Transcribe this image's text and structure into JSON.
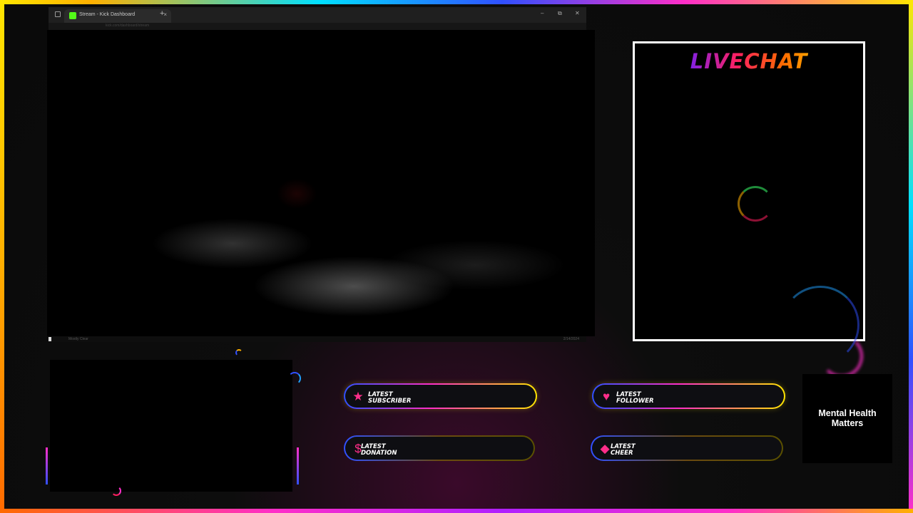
{
  "browser": {
    "tab_title": "Stream - Kick Dashboard",
    "tab_close": "×",
    "new_tab": "+",
    "window_controls": {
      "minimize": "–",
      "restore": "⧉",
      "close": "✕"
    },
    "address_text": "kick.com/dashboard/stream",
    "taskbar_text": "Mostly Clear",
    "taskbar_clock": "2/14/2024"
  },
  "chat": {
    "title": "LIVECHAT"
  },
  "alerts": [
    {
      "line1": "LATEST",
      "line2": "SUBSCRIBER",
      "icon": "star-icon",
      "glyph": "★"
    },
    {
      "line1": "LATEST",
      "line2": "FOLLOWER",
      "icon": "heart-icon",
      "glyph": "♥"
    },
    {
      "line1": "LATEST",
      "line2": "DONATION",
      "icon": "dollar-icon",
      "glyph": "$"
    },
    {
      "line1": "LATEST",
      "line2": "CHEER",
      "icon": "diamond-icon",
      "glyph": "◆"
    }
  ],
  "message_box": {
    "line1": "Mental Health",
    "line2": "Matters"
  },
  "colors": {
    "frame_gradient": [
      "#ffe600",
      "#00e0ff",
      "#3050ff",
      "#ff2ec8"
    ],
    "alert_icon": "#ff2e8a",
    "chat_border": "#ffffff"
  }
}
